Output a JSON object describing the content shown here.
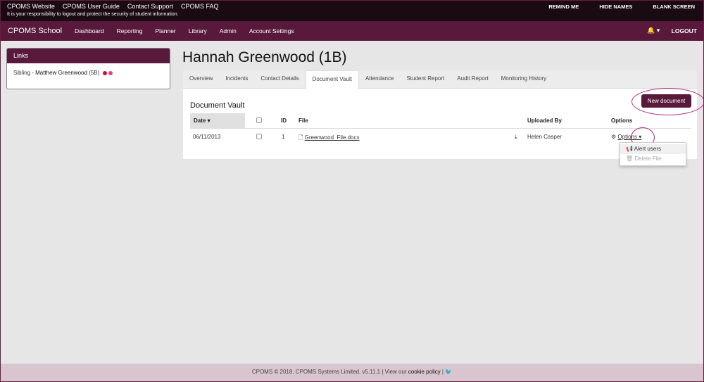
{
  "topbar": {
    "links": [
      "CPOMS Website",
      "CPOMS User Guide",
      "Contact Support",
      "CPOMS FAQ"
    ],
    "notice": "It is your responsibility to logout and protect the security of student information.",
    "remind_me": "REMIND ME",
    "hide_names": "HIDE NAMES",
    "blank_screen": "BLANK SCREEN"
  },
  "nav": {
    "brand": "CPOMS School",
    "items": [
      "Dashboard",
      "Reporting",
      "Planner",
      "Library",
      "Admin",
      "Account Settings"
    ],
    "bell": "🔔 ▾",
    "logout": "LOGOUT"
  },
  "links_panel": {
    "title": "Links",
    "sibling_prefix": "Sibling - ",
    "sibling_name": "Matthew Greenwood",
    "sibling_class": "(5B)",
    "dot_colors": [
      "#c0143c",
      "#e83e8c"
    ]
  },
  "student": {
    "name": "Hannah Greenwood (1B)"
  },
  "tabs": [
    "Overview",
    "Incidents",
    "Contact Details",
    "Document Vault",
    "Attendance",
    "Student Report",
    "Audit Report",
    "Monitoring History"
  ],
  "active_tab": "Document Vault",
  "vault": {
    "title": "Document Vault",
    "new_button": "New document",
    "headers": {
      "date": "Date ▾",
      "id": "ID",
      "file": "File",
      "uploaded_by": "Uploaded By",
      "options": "Options"
    },
    "row": {
      "date": "06/11/2013",
      "id": "1",
      "file": "Greenwood_File.docx",
      "uploaded_by": "Helen Casper",
      "options": "Options ▾"
    },
    "dropdown": {
      "alert": "Alert users",
      "delete": "Delete File"
    }
  },
  "footer": {
    "text": "CPOMS © 2018, CPOMS Systems Limited. v5.11.1 | View our ",
    "cookie": "cookie policy",
    "sep": " | "
  },
  "colors": {
    "brand": "#58193b",
    "topbar": "#1a0a12",
    "annotation": "#b3267a"
  }
}
